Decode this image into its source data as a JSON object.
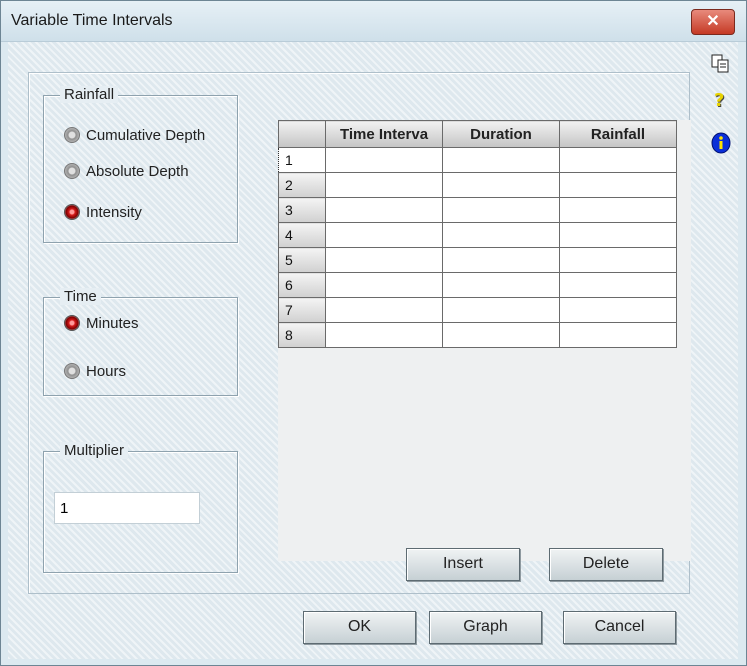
{
  "window": {
    "title": "Variable Time Intervals",
    "close_label": "✕"
  },
  "rainfall": {
    "legend": "Rainfall",
    "options": [
      {
        "label": "Cumulative Depth",
        "selected": false
      },
      {
        "label": "Absolute Depth",
        "selected": false
      },
      {
        "label": "Intensity",
        "selected": true
      }
    ]
  },
  "time": {
    "legend": "Time",
    "options": [
      {
        "label": "Minutes",
        "selected": true
      },
      {
        "label": "Hours",
        "selected": false
      }
    ]
  },
  "multiplier": {
    "legend": "Multiplier",
    "value": "1"
  },
  "grid": {
    "columns": [
      "Time Interva",
      "Duration",
      "Rainfall"
    ],
    "rows": [
      "1",
      "2",
      "3",
      "4",
      "5",
      "6",
      "7",
      "8"
    ]
  },
  "buttons": {
    "insert": "Insert",
    "delete": "Delete",
    "ok": "OK",
    "graph": "Graph",
    "cancel": "Cancel"
  },
  "side_icons": {
    "copy": "copy-icon",
    "help": "?",
    "info": "i"
  }
}
